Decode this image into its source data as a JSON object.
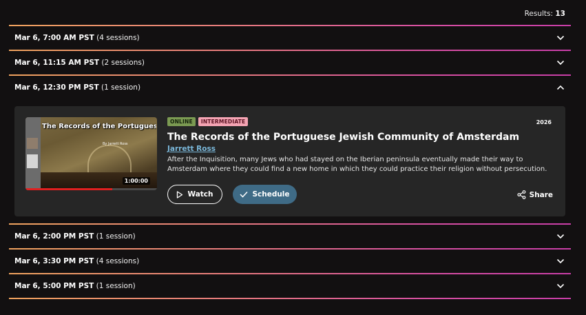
{
  "results": {
    "label": "Results:",
    "count": "13"
  },
  "groups": [
    {
      "date": "Mar 6, 7:00 AM PST",
      "count": "(4 sessions)",
      "expanded": false
    },
    {
      "date": "Mar 6, 11:15 AM PST",
      "count": "(2 sessions)",
      "expanded": false
    },
    {
      "date": "Mar 6, 12:30 PM PST",
      "count": "(1 session)",
      "expanded": true
    },
    {
      "date": "Mar 6, 2:00 PM PST",
      "count": "(1 session)",
      "expanded": false
    },
    {
      "date": "Mar 6, 3:30 PM PST",
      "count": "(4 sessions)",
      "expanded": false
    },
    {
      "date": "Mar 6, 5:00 PM PST",
      "count": "(1 session)",
      "expanded": false
    }
  ],
  "session": {
    "thumbnail_title": "The Records of the Portuguese Jewish Community of Amsterdam",
    "thumbnail_byline": "By Jarrett Ross",
    "duration": "1:00:00",
    "progress": 0.66,
    "badges": [
      "ONLINE",
      "INTERMEDIATE"
    ],
    "year": "2026",
    "title": "The Records of the Portuguese Jewish Community of Amsterdam",
    "speaker": "Jarrett Ross",
    "description": "After the Inquisition, many Jews who had stayed on the Iberian peninsula eventually made their way to Amsterdam where they could find a new home in which they could practice their religion without persecution. The records of the Portuguese Jewish Community of Amsterdam are a rich resource for genealogists.",
    "watch_label": "Watch",
    "schedule_label": "Schedule",
    "share_label": "Share"
  },
  "colors": {
    "background": "#121011",
    "card": "#262626",
    "accent_gradient": [
      "#f0a35e",
      "#d74fa3"
    ],
    "schedule_button": "#3f6b86",
    "speaker_link": "#7ab7d9"
  }
}
